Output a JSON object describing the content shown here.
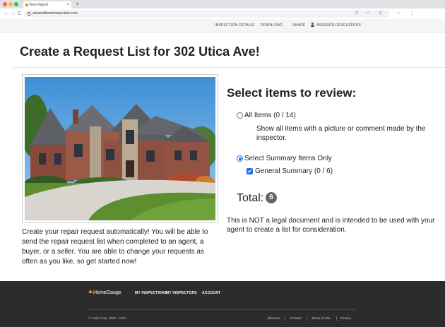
{
  "browser": {
    "tab_title": "View Report",
    "tab_close": "×",
    "new_tab": "+",
    "url": "assuredhomeinspectors.com",
    "nav_back": "←",
    "nav_forward": "→",
    "nav_reload": "C",
    "omnibox_icons": "⚲ ☆ ⊙",
    "extension_icons": "◔ ⋮"
  },
  "site_nav": {
    "items": [
      {
        "label": "INSPECTION DETAILS"
      },
      {
        "label": "DOWNLOAD"
      },
      {
        "label": "SHARE"
      },
      {
        "label": "ASSURED DEVELOPERS",
        "icon": "person-icon"
      }
    ]
  },
  "page": {
    "title": "Create a Request List for 302 Utica Ave!",
    "blurb": "Create your repair request automatically! You will be able to send the repair request list when completed to an agent, a buyer, or a seller. You are able to change your requests as often as you like, so get started now!"
  },
  "review": {
    "heading": "Select items to review:",
    "option_all": {
      "label": "All Items (0 / 14)",
      "description": "Show all items with a picture or comment made by the inspector.",
      "selected": false
    },
    "option_summary": {
      "label": "Select Summary Items Only",
      "selected": true
    },
    "general_summary": {
      "label": "General Summary (0 / 6)",
      "checked": true
    },
    "total_label": "Total:",
    "total_count": "6",
    "legal_note": "This is NOT a legal document and is intended to be used with your agent to create a list for consideration."
  },
  "footer": {
    "logo": "HomeGauge",
    "links": [
      "MY INSPECTIONS",
      "MY INSPECTORS",
      "ACCOUNT"
    ],
    "copyright": "© SHGI Corp. 2002 - 2021",
    "bottom_links": [
      "About Us",
      "Contact",
      "Terms of Use",
      "Privacy"
    ]
  },
  "colors": {
    "accent": "#1a73e8",
    "footer_bg": "#2c2c2c",
    "badge_bg": "#666666",
    "logo_orange": "#f28a1e"
  }
}
